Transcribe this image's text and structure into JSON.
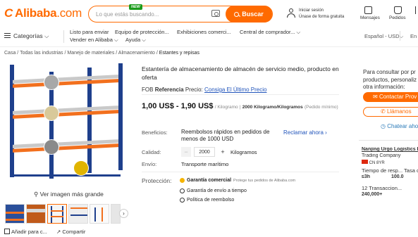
{
  "header": {
    "logo_text": "Alibaba",
    "logo_suffix": ".com",
    "search_placeholder": "Lo que estás buscando...",
    "new_badge": "NEW",
    "search_button": "Buscar",
    "signin_line1": "Iniciar sesión",
    "signin_line2": "Únase de forma gratuita",
    "messages_label": "Mensajes",
    "orders_label": "Pedidos"
  },
  "nav": {
    "categories": "Categorías",
    "items": [
      "Listo para enviar",
      "Equipo de protección...",
      "Exhibiciones comerci...",
      "Central de comprador..."
    ],
    "items2": [
      "Vender en Alibaba",
      "Ayuda"
    ],
    "language": "Español - USD",
    "cut_right": "En"
  },
  "breadcrumb": [
    "Casa",
    "Todas las industrias",
    "Manejo de materiales",
    "Almacenamiento",
    "Estantes y repisas"
  ],
  "gallery": {
    "view_large": "Ver imagen más grande",
    "add_compare": "Añadir para c...",
    "share": "Compartir",
    "next_arrow": "›"
  },
  "product": {
    "title": "Estantería de almacenamiento de almacén de servicio medio, producto en oferta",
    "fob_prefix": "FOB",
    "fob_ref": "Referencia",
    "fob_price_label": "Precio:",
    "fob_link": "Consiga El Último Precio",
    "price_range": "1,00 US$ - 1,90 US$",
    "price_unit": "/ Kilogramo",
    "moq": "2000 Kilogramo/Kilogramos",
    "moq_note": "(Pedido mínimo)",
    "benefits_label": "Beneficios:",
    "benefits_value": "Reembolsos rápidos en pedidos de menos de 1000 USD",
    "claim_link": "Reclamar ahora ›",
    "quantity_label": "Calidad:",
    "quantity_minus": "−",
    "quantity_value": "2000",
    "quantity_plus": "+",
    "quantity_unit": "Kilogramos",
    "shipping_label": "Envío:",
    "shipping_value": "Transporte marítimo",
    "protection_label": "Protección:",
    "protection_main": "Garantía comercial",
    "protection_note": "Protege tus pedidos de Alibaba.com",
    "protection_item2": "Garantía de envío a tiempo",
    "protection_item3": "Política de reembolso"
  },
  "side": {
    "line1": "Para consultar por pr",
    "line2": "productos, personaliz",
    "line3": "otra información:",
    "contact_button": "Contactar Prov",
    "call_button": "Llámanos",
    "chat_link": "Chatear aho",
    "supplier_name": "Nanjing Urgo Logistics Eq",
    "supplier_type": "Trading Company",
    "supplier_country": "CN",
    "supplier_years": "8YR",
    "resp_label": "Tiempo de resp...",
    "resp_value": "≤3h",
    "rate_label": "Tasa c",
    "rate_value": "100.0",
    "trans_label": "12 Transaccion...",
    "trans_value": "240,000+"
  },
  "colors": {
    "brand": "#ff6a00",
    "link": "#2255bb",
    "rack_upright": "#1e3f8c",
    "rack_beam": "#f2701e"
  }
}
